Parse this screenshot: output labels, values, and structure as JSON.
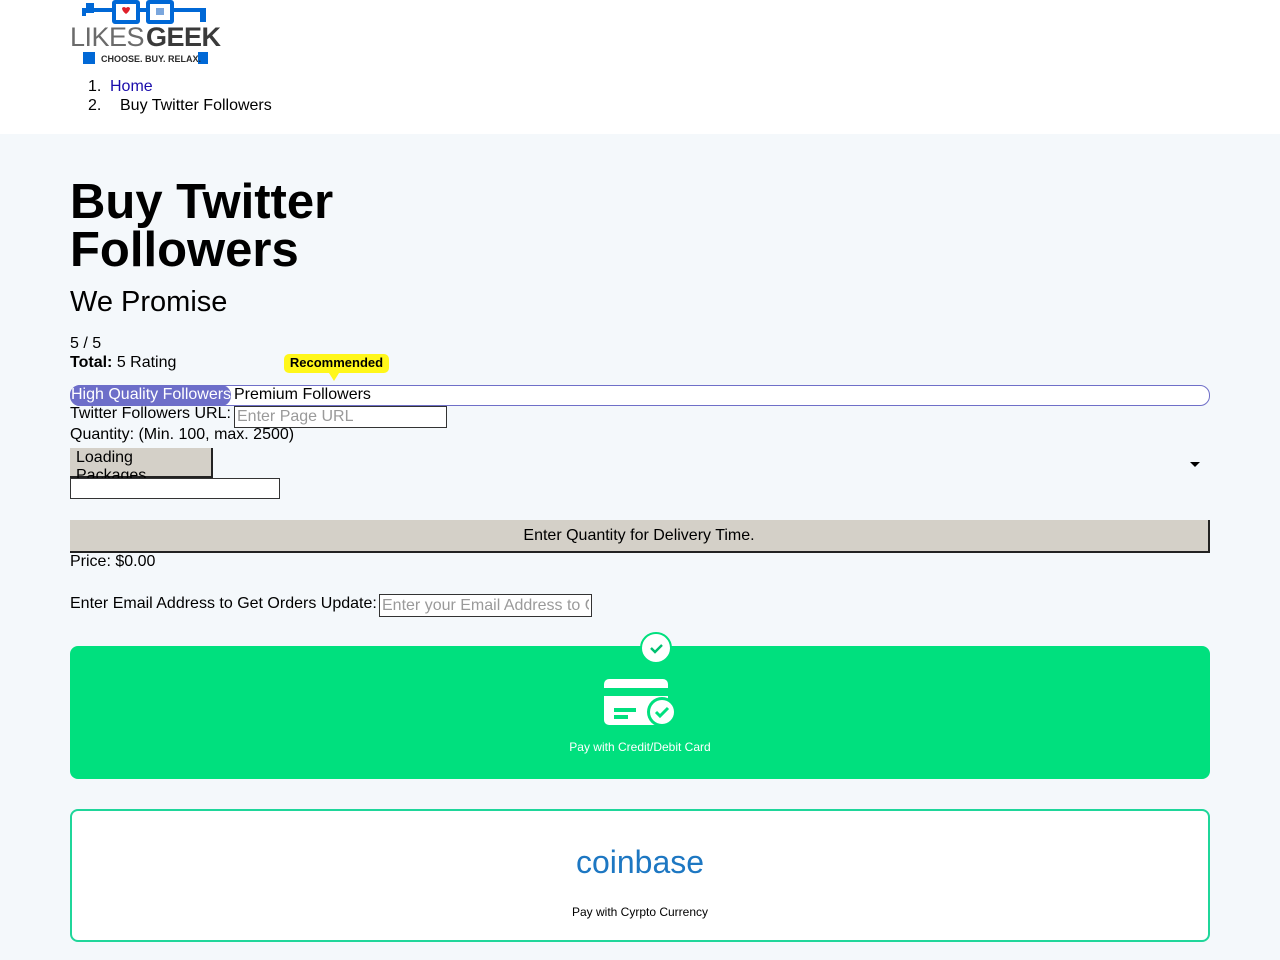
{
  "brand": {
    "name": "LIKESGEEK",
    "tagline": "CHOOSE. BUY. RELAX.",
    "colors": {
      "blue": "#0068d6",
      "dark": "#3a3a3a",
      "heart": "#e0202a"
    }
  },
  "breadcrumb": {
    "items": [
      {
        "num": "1.",
        "label": "Home"
      },
      {
        "num": "2.",
        "label": "Buy Twitter Followers"
      }
    ]
  },
  "page": {
    "title": "Buy Twitter Followers",
    "subtitle": "We Promise"
  },
  "rating": {
    "score": "5 / 5",
    "total_label": "Total:",
    "total_value": "5 Rating"
  },
  "tabs": {
    "badge": "Recommended",
    "items": [
      {
        "label": "High Quality Followers",
        "active": true
      },
      {
        "label": "Premium Followers",
        "active": false
      }
    ]
  },
  "form": {
    "url_label": "Twitter Followers URL:",
    "url_placeholder": "Enter Page URL",
    "quantity_label": "Quantity: (Min. 100, max. 2500)",
    "package_select": "Loading Packages",
    "delivery_button": "Enter Quantity for Delivery Time.",
    "price": "Price: $0.00",
    "email_label": "Enter Email Address to Get Orders Update:",
    "email_placeholder": "Enter your Email Address to Get Orders Update"
  },
  "payment": {
    "card_label": "Pay with Credit/Debit Card",
    "crypto_brand": "coinbase",
    "crypto_label": "Pay with Cyrpto Currency",
    "colors": {
      "card_bg": "#00e07e",
      "crypto_border": "#1fd69a",
      "coinbase": "#1d77c2"
    }
  },
  "icons": {
    "selected": "check-circle-icon",
    "card": "credit-card-check-icon",
    "select_arrow": "chevron-down-icon"
  }
}
